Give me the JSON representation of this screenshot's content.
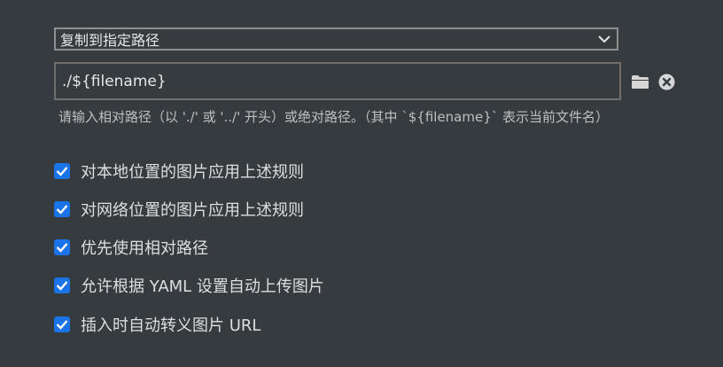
{
  "destination_select": {
    "selected": "复制到指定路径"
  },
  "path_field": {
    "value": "./${filename}"
  },
  "hint": "请输入相对路径（以 './' 或 '../' 开头）或绝对路径。（其中 `${filename}` 表示当前文件名）",
  "options": [
    {
      "label": "对本地位置的图片应用上述规则",
      "checked": true
    },
    {
      "label": "对网络位置的图片应用上述规则",
      "checked": true
    },
    {
      "label": "优先使用相对路径",
      "checked": true
    },
    {
      "label": "允许根据 YAML 设置自动上传图片",
      "checked": true
    },
    {
      "label": "插入时自动转义图片 URL",
      "checked": true
    }
  ],
  "colors": {
    "background": "#363b40",
    "checkbox": "#1a73e8"
  },
  "icons": [
    "chevron-down-icon",
    "folder-icon",
    "clear-icon",
    "checkmark-icon"
  ]
}
